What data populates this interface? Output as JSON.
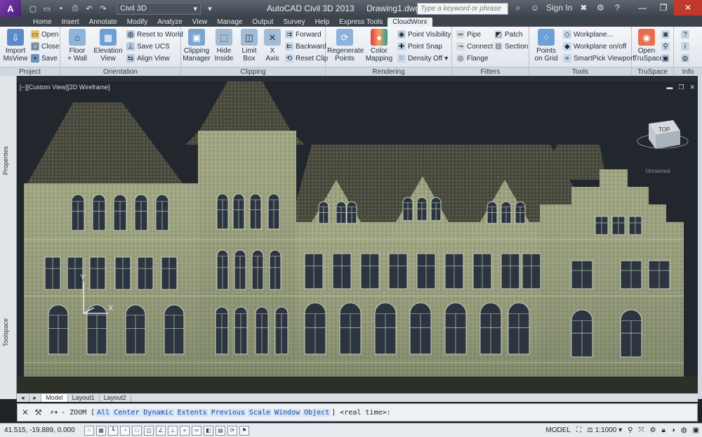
{
  "titlebar": {
    "app_logo": "A",
    "workspace": "Civil 3D",
    "app_title": "AutoCAD Civil 3D 2013",
    "document": "Drawing1.dwg",
    "search_placeholder": "Type a keyword or phrase",
    "signin": "Sign In"
  },
  "tabs": [
    "Home",
    "Insert",
    "Annotate",
    "Modify",
    "Analyze",
    "View",
    "Manage",
    "Output",
    "Survey",
    "Help",
    "Express Tools",
    "CloudWorx"
  ],
  "active_tab": "CloudWorx",
  "ribbon": {
    "project": {
      "label": "Project",
      "import_line1": "Import",
      "import_line2": "MsView",
      "open": "Open",
      "close": "Close",
      "save": "Save"
    },
    "orientation": {
      "label": "Orientation",
      "floor_line1": "Floor",
      "floor_line2": "+ Wall",
      "elevation_line1": "Elevation",
      "elevation_line2": "View",
      "reset_world": "Reset to World",
      "save_ucs": "Save UCS",
      "align_view": "Align View"
    },
    "clipping": {
      "label": "Clipping",
      "manager_line1": "Clipping",
      "manager_line2": "Manager",
      "hide_line1": "Hide",
      "hide_line2": "Inside",
      "limit_line1": "Limit",
      "limit_line2": "Box",
      "xaxis_line1": "X",
      "xaxis_line2": "Axis",
      "forward": "Forward",
      "backward": "Backward",
      "reset_clip": "Reset Clip"
    },
    "rendering": {
      "label": "Rendering",
      "regen_line1": "Regenerate",
      "regen_line2": "Points",
      "color_line1": "Color",
      "color_line2": "Mapping",
      "point_visibility": "Point Visibility",
      "point_snap": "Point Snap",
      "density": "Density Off"
    },
    "fitters": {
      "label": "Fitters",
      "pipe": "Pipe",
      "connect": "Connect",
      "flange": "Flange",
      "patch": "Patch",
      "section": "Section"
    },
    "tools": {
      "label": "Tools",
      "points_line1": "Points",
      "points_line2": "on Grid",
      "workplane": "Workplane...",
      "workplane_toggle": "Workplane on/off",
      "smartpick": "SmartPick Viewport"
    },
    "truspace": {
      "label": "TruSpace",
      "open_line1": "Open",
      "open_line2": "TruSpace"
    },
    "info": {
      "label": "Info"
    }
  },
  "viewport": {
    "label": "[−][Custom View][2D Wireframe]",
    "viewcube_face": "TOP",
    "viewcube_name": "Unnamed",
    "ucs_x": "X",
    "ucs_y": "Y"
  },
  "palettes": {
    "properties": "Properties",
    "toolspace": "Toolspace"
  },
  "layout_tabs": [
    "Model",
    "Layout1",
    "Layout2"
  ],
  "command_line": {
    "prefix": "- ZOOM [",
    "options": [
      "All",
      "Center",
      "Dynamic",
      "Extents",
      "Previous",
      "Scale",
      "Window",
      "Object"
    ],
    "suffix": "] <real time>:"
  },
  "statusbar": {
    "coords": "41.515, -19.889, 0.000",
    "model": "MODEL",
    "scale": "1:1000"
  }
}
